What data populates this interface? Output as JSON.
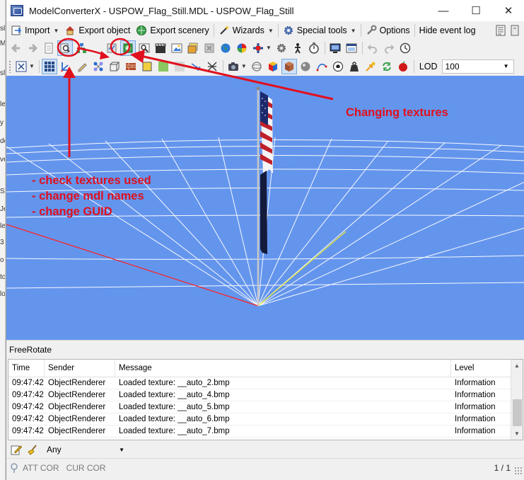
{
  "window": {
    "title": "ModelConverterX - USPOW_Flag_Still.MDL - USPOW_Flag_Still",
    "minimize": "—",
    "maximize": "☐",
    "close": "✕"
  },
  "background_window_fragments": [
    "sl",
    "Mi",
    "sl",
    "le",
    "y",
    "de",
    "ve",
    "S",
    "Je",
    "le",
    "3",
    "o",
    "to",
    "lo"
  ],
  "menu": {
    "import": "Import",
    "export_object": "Export object",
    "export_scenery": "Export scenery",
    "wizards": "Wizards",
    "special_tools": "Special tools",
    "options": "Options",
    "hide_event_log": "Hide event log"
  },
  "toolbar2": {
    "lod_label": "LOD",
    "lod_value": "100"
  },
  "annotations": {
    "changing_textures": "Changing textures",
    "check_textures": "- check textures used",
    "change_mdl_names": "- change mdl names",
    "change_guid": "- change GUID"
  },
  "colors": {
    "viewport_bg": "#6495ed",
    "annotation_red": "#e0101e",
    "grid_line": "#ffffff",
    "axis_red": "#ff2020",
    "axis_yellow": "#e8e82a"
  },
  "log": {
    "panel_title": "FreeRotate",
    "columns": [
      "Time",
      "Sender",
      "Message",
      "Level"
    ],
    "rows": [
      [
        "09:47:42",
        "ObjectRenderer",
        "Loaded texture: __auto_2.bmp",
        "Information"
      ],
      [
        "09:47:42",
        "ObjectRenderer",
        "Loaded texture: __auto_4.bmp",
        "Information"
      ],
      [
        "09:47:42",
        "ObjectRenderer",
        "Loaded texture: __auto_5.bmp",
        "Information"
      ],
      [
        "09:47:42",
        "ObjectRenderer",
        "Loaded texture: __auto_6.bmp",
        "Information"
      ],
      [
        "09:47:42",
        "ObjectRenderer",
        "Loaded texture: __auto_7.bmp",
        "Information"
      ]
    ]
  },
  "filter": {
    "level_value": "Any"
  },
  "status": {
    "att_cor": "ATT COR",
    "cur_cor": "CUR COR",
    "page": "1 / 1"
  }
}
